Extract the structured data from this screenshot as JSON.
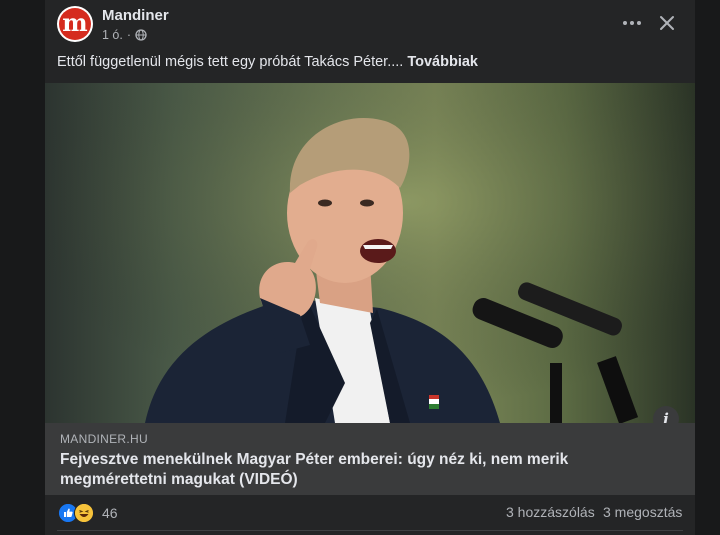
{
  "post": {
    "page_name": "Mandiner",
    "time": "1 ó.",
    "audience_icon": "globe-icon",
    "text": "Ettől függetlenül mégis tett egy próbát Takács Péter....",
    "see_more": "Továbbiak"
  },
  "link_preview": {
    "domain": "MANDINER.HU",
    "headline": "Fejvesztve menekülnek Magyar Péter emberei: úgy néz ki, nem merik megmérettetni magukat (VIDEÓ)"
  },
  "stats": {
    "reactions": [
      "like-icon",
      "haha-icon"
    ],
    "reaction_count": "46",
    "comments": "3 hozzászólás",
    "shares": "3 megosztás"
  },
  "colors": {
    "background": "#18191a",
    "card": "#242526",
    "link_box": "#3a3b3c",
    "like_blue": "#1877f2",
    "brand_red": "#d52b1e"
  }
}
